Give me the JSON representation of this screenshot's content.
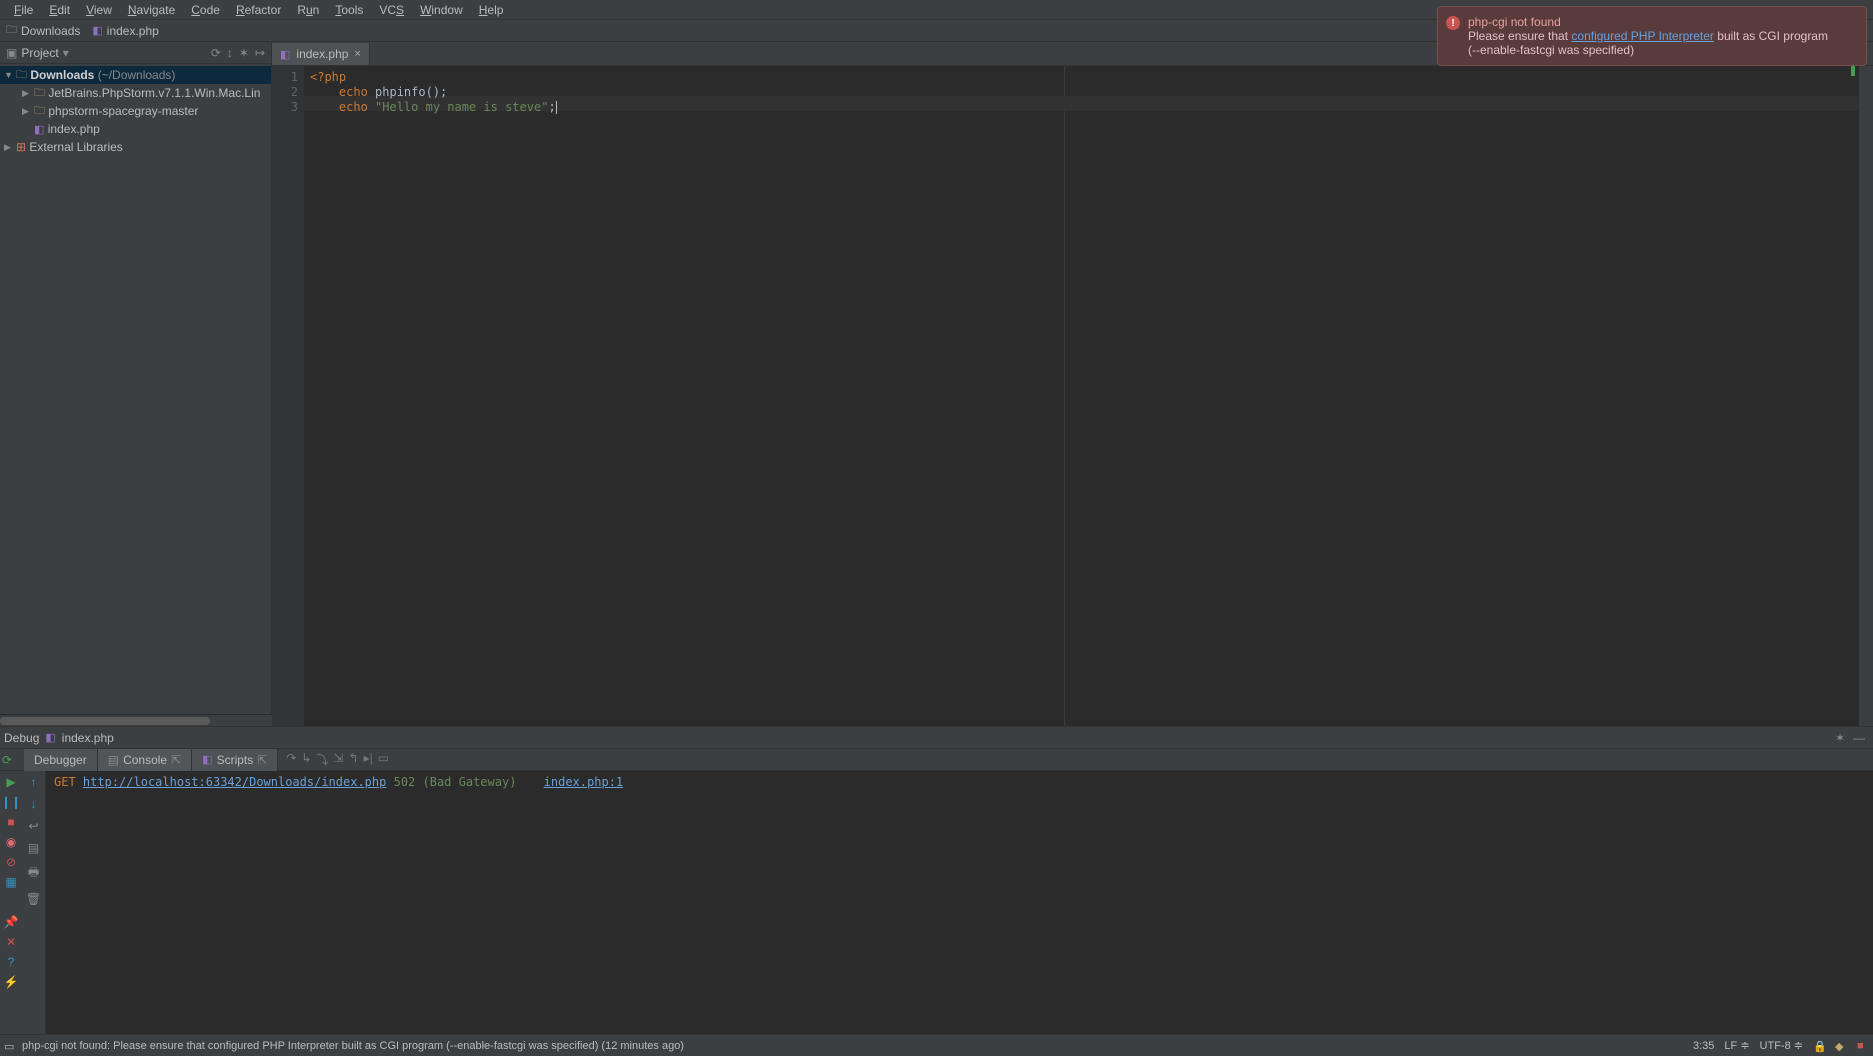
{
  "menu": [
    "File",
    "Edit",
    "View",
    "Navigate",
    "Code",
    "Refactor",
    "Run",
    "Tools",
    "VCS",
    "Window",
    "Help"
  ],
  "breadcrumb": {
    "folder": "Downloads",
    "file": "index.php"
  },
  "notification": {
    "title": "php-cgi not found",
    "line1a": "Please ensure that ",
    "link": "configured PHP Interpreter",
    "line1b": " built as CGI program",
    "line2": "(--enable-fastcgi was specified)"
  },
  "sidebar": {
    "title": "Project",
    "root": {
      "name": "Downloads",
      "path": "(~/Downloads)"
    },
    "children": [
      {
        "type": "folder",
        "name": "JetBrains.PhpStorm.v7.1.1.Win.Mac.Lin"
      },
      {
        "type": "folder",
        "name": "phpstorm-spacegray-master"
      },
      {
        "type": "php",
        "name": "index.php"
      }
    ],
    "libs": "External Libraries"
  },
  "editor": {
    "tab": "index.php",
    "lines": [
      "1",
      "2",
      "3"
    ],
    "code": {
      "l1_open": "<?php",
      "l2_echo": "echo",
      "l2_call": " phpinfo();",
      "l3_echo": "echo",
      "l3_str": " \"Hello my name is steve\"",
      "l3_semi": ";"
    }
  },
  "debug": {
    "label": "Debug",
    "config": "index.php",
    "tabs": {
      "debugger": "Debugger",
      "console": "Console",
      "scripts": "Scripts"
    },
    "console": {
      "method": "GET",
      "url": "http://localhost:63342/Downloads/index.php",
      "status": "502 (Bad Gateway)",
      "link": "index.php:1"
    }
  },
  "status": {
    "msg": "php-cgi not found: Please ensure that configured PHP Interpreter built as CGI program (--enable-fastcgi was specified) (12 minutes ago)",
    "pos": "3:35",
    "le": "LF",
    "enc": "UTF-8"
  }
}
